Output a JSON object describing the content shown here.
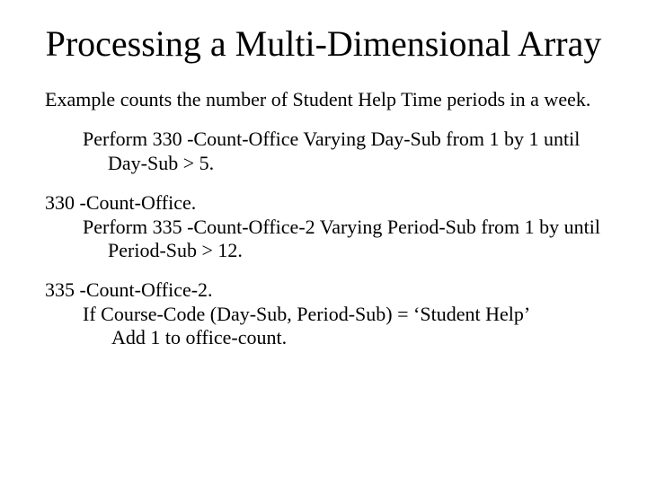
{
  "title": "Processing a Multi-Dimensional Array",
  "paragraphs": {
    "intro": "Example counts the number of Student Help Time periods in a week.",
    "perform1": "Perform 330 -Count-Office Varying Day-Sub from 1 by 1 until Day-Sub > 5.",
    "label330": "330 -Count-Office.",
    "perform2": "Perform 335 -Count-Office-2 Varying Period-Sub from 1 by until Period-Sub > 12.",
    "label335": "335 -Count-Office-2.",
    "ifline": "If Course-Code (Day-Sub, Period-Sub) = ‘Student Help’",
    "addline": "Add 1 to office-count."
  }
}
